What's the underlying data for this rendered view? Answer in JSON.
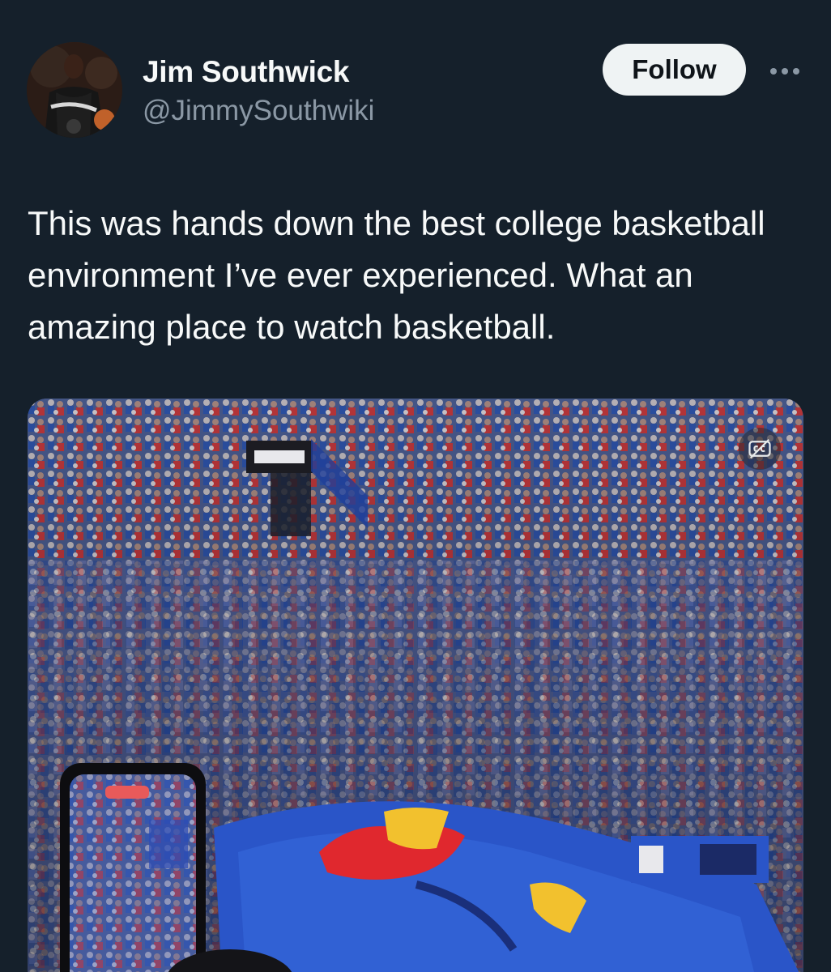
{
  "author": {
    "name": "Jim Southwick",
    "handle": "@JimmySouthwiki",
    "avatar_icon": "avatar-photo"
  },
  "actions": {
    "follow_label": "Follow",
    "more_icon": "more-horizontal-icon"
  },
  "tweet": {
    "text": "This was hands down the best college basketball environment I’ve ever experienced. What an amazing place to watch basketball."
  },
  "media": {
    "type": "video",
    "captions_icon": "closed-captions-off-icon"
  },
  "colors": {
    "background": "#15202b",
    "text_primary": "#f7f9f9",
    "text_secondary": "#8b98a5",
    "follow_button_bg": "#eff3f4",
    "follow_button_text": "#0f1419"
  }
}
